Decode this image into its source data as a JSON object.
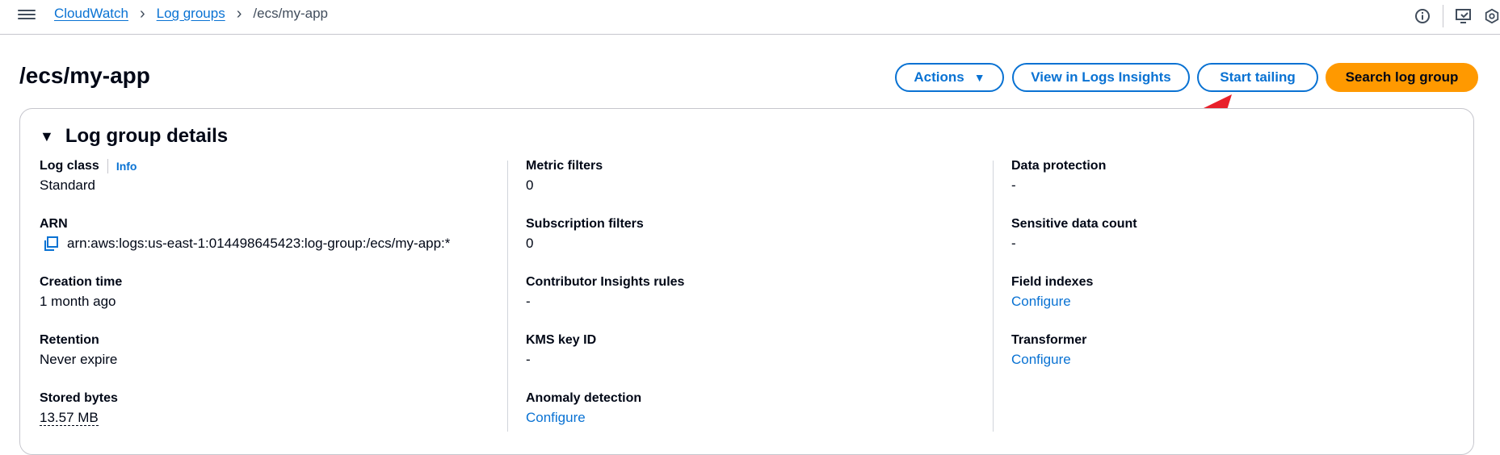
{
  "breadcrumbs": [
    {
      "label": "CloudWatch"
    },
    {
      "label": "Log groups"
    }
  ],
  "breadcrumb_current": "/ecs/my-app",
  "page_title": "/ecs/my-app",
  "actions": {
    "actions_label": "Actions",
    "logs_insights_label": "View in Logs Insights",
    "start_tailing_label": "Start tailing",
    "search_label": "Search log group"
  },
  "details": {
    "heading": "Log group details",
    "info_link": "Info",
    "col1": {
      "log_class_label": "Log class",
      "log_class_value": "Standard",
      "arn_label": "ARN",
      "arn_value": "arn:aws:logs:us-east-1:014498645423:log-group:/ecs/my-app:*",
      "creation_label": "Creation time",
      "creation_value": "1 month ago",
      "retention_label": "Retention",
      "retention_value": "Never expire",
      "stored_label": "Stored bytes",
      "stored_value": "13.57 MB"
    },
    "col2": {
      "metric_label": "Metric filters",
      "metric_value": "0",
      "subscription_label": "Subscription filters",
      "subscription_value": "0",
      "contributor_label": "Contributor Insights rules",
      "contributor_value": "-",
      "kms_label": "KMS key ID",
      "kms_value": "-",
      "anomaly_label": "Anomaly detection",
      "anomaly_value": "Configure"
    },
    "col3": {
      "data_protection_label": "Data protection",
      "data_protection_value": "-",
      "sensitive_label": "Sensitive data count",
      "sensitive_value": "-",
      "field_indexes_label": "Field indexes",
      "field_indexes_value": "Configure",
      "transformer_label": "Transformer",
      "transformer_value": "Configure"
    }
  },
  "colors": {
    "link": "#0972d3",
    "primary_button": "#ff9900",
    "annotation_arrow": "#e8202a"
  }
}
